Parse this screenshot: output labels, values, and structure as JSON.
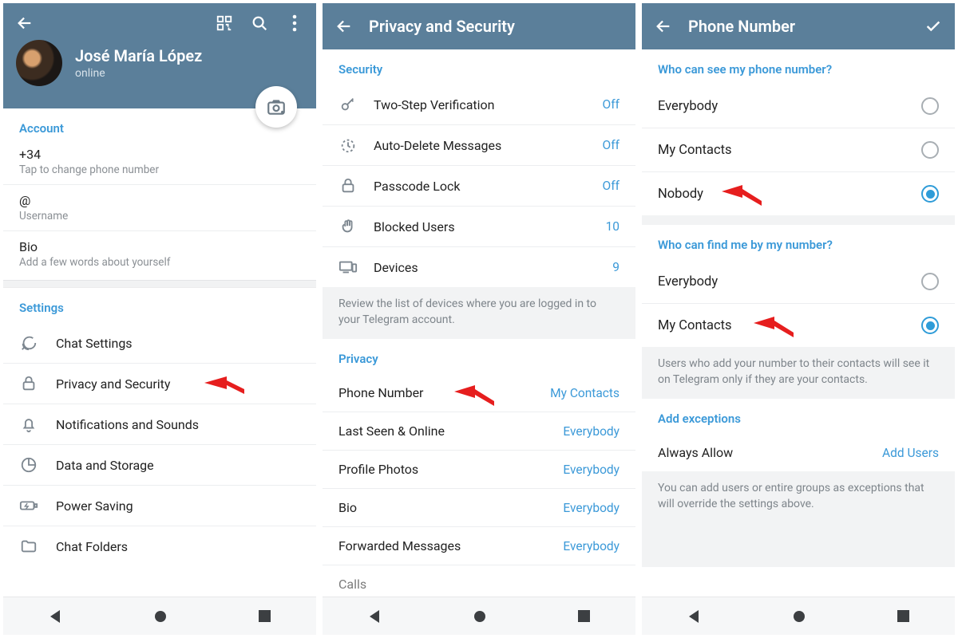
{
  "s1": {
    "profile_name": "José María López",
    "profile_status": "online",
    "account_header": "Account",
    "phone_value": "+34",
    "phone_sub": "Tap to change phone number",
    "username_value": "@",
    "username_sub": "Username",
    "bio_value": "Bio",
    "bio_sub": "Add a few words about yourself",
    "settings_header": "Settings",
    "settings": {
      "chat": "Chat Settings",
      "privacy": "Privacy and Security",
      "notifications": "Notifications and Sounds",
      "data": "Data and Storage",
      "power": "Power Saving",
      "folders": "Chat Folders"
    }
  },
  "s2": {
    "title": "Privacy and Security",
    "security_header": "Security",
    "twostep": {
      "label": "Two-Step Verification",
      "val": "Off"
    },
    "autodel": {
      "label": "Auto-Delete Messages",
      "val": "Off"
    },
    "passcode": {
      "label": "Passcode Lock",
      "val": "Off"
    },
    "blocked": {
      "label": "Blocked Users",
      "val": "10"
    },
    "devices": {
      "label": "Devices",
      "val": "9"
    },
    "devices_note": "Review the list of devices where you are logged in to your Telegram account.",
    "privacy_header": "Privacy",
    "phone": {
      "label": "Phone Number",
      "val": "My Contacts"
    },
    "lastseen": {
      "label": "Last Seen & Online",
      "val": "Everybody"
    },
    "photos": {
      "label": "Profile Photos",
      "val": "Everybody"
    },
    "bio": {
      "label": "Bio",
      "val": "Everybody"
    },
    "fwd": {
      "label": "Forwarded Messages",
      "val": "Everybody"
    },
    "calls_label": "Calls"
  },
  "s3": {
    "title": "Phone Number",
    "see_header": "Who can see my phone number?",
    "see": {
      "everybody": "Everybody",
      "contacts": "My Contacts",
      "nobody": "Nobody"
    },
    "find_header": "Who can find me by my number?",
    "find": {
      "everybody": "Everybody",
      "contacts": "My Contacts"
    },
    "find_note": "Users who add your number to their contacts will see it on Telegram only if they are your contacts.",
    "exceptions_header": "Add exceptions",
    "always_allow": "Always Allow",
    "add_users": "Add Users",
    "exceptions_note": "You can add users or entire groups as exceptions that will override the settings above."
  }
}
